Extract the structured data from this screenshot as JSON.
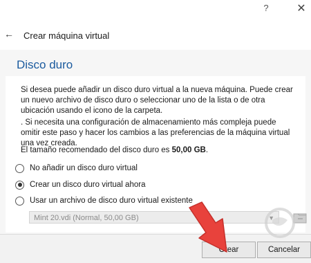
{
  "window": {
    "help_glyph": "?",
    "close_glyph": "✕"
  },
  "header": {
    "back_glyph": "←",
    "title": "Crear máquina virtual"
  },
  "page": {
    "section_title": "Disco duro",
    "paragraph1": "Si desea puede añadir un disco duro virtual a la nueva máquina. Puede crear un nuevo archivo de disco duro o seleccionar uno de la lista o de otra ubicación usando el icono de la carpeta.",
    "paragraph2": ". Si necesita una configuración de almacenamiento más compleja puede omitir este paso y hacer los cambios a las preferencias de la máquina virtual una vez creada.",
    "recommend_prefix": "El tamaño recomendado del disco duro es ",
    "recommend_size": "50,00 GB",
    "recommend_suffix": ".",
    "options": [
      {
        "label": "No añadir un disco duro virtual",
        "checked": false
      },
      {
        "label": "Crear un disco duro virtual ahora",
        "checked": true
      },
      {
        "label": "Usar un archivo de disco duro virtual existente",
        "checked": false
      }
    ],
    "existing_file": "Mint 20.vdi (Normal, 50,00 GB)"
  },
  "footer": {
    "create_label": "Crear",
    "cancel_label": "Cancelar"
  },
  "colors": {
    "section_title": "#1a5a9e",
    "arrow": "#e8423c"
  },
  "icons": {
    "back": "arrow-left-icon",
    "folder": "folder-icon",
    "arrow_annotation": "red-arrow-annotation",
    "watermark": "solvetic-logo"
  }
}
